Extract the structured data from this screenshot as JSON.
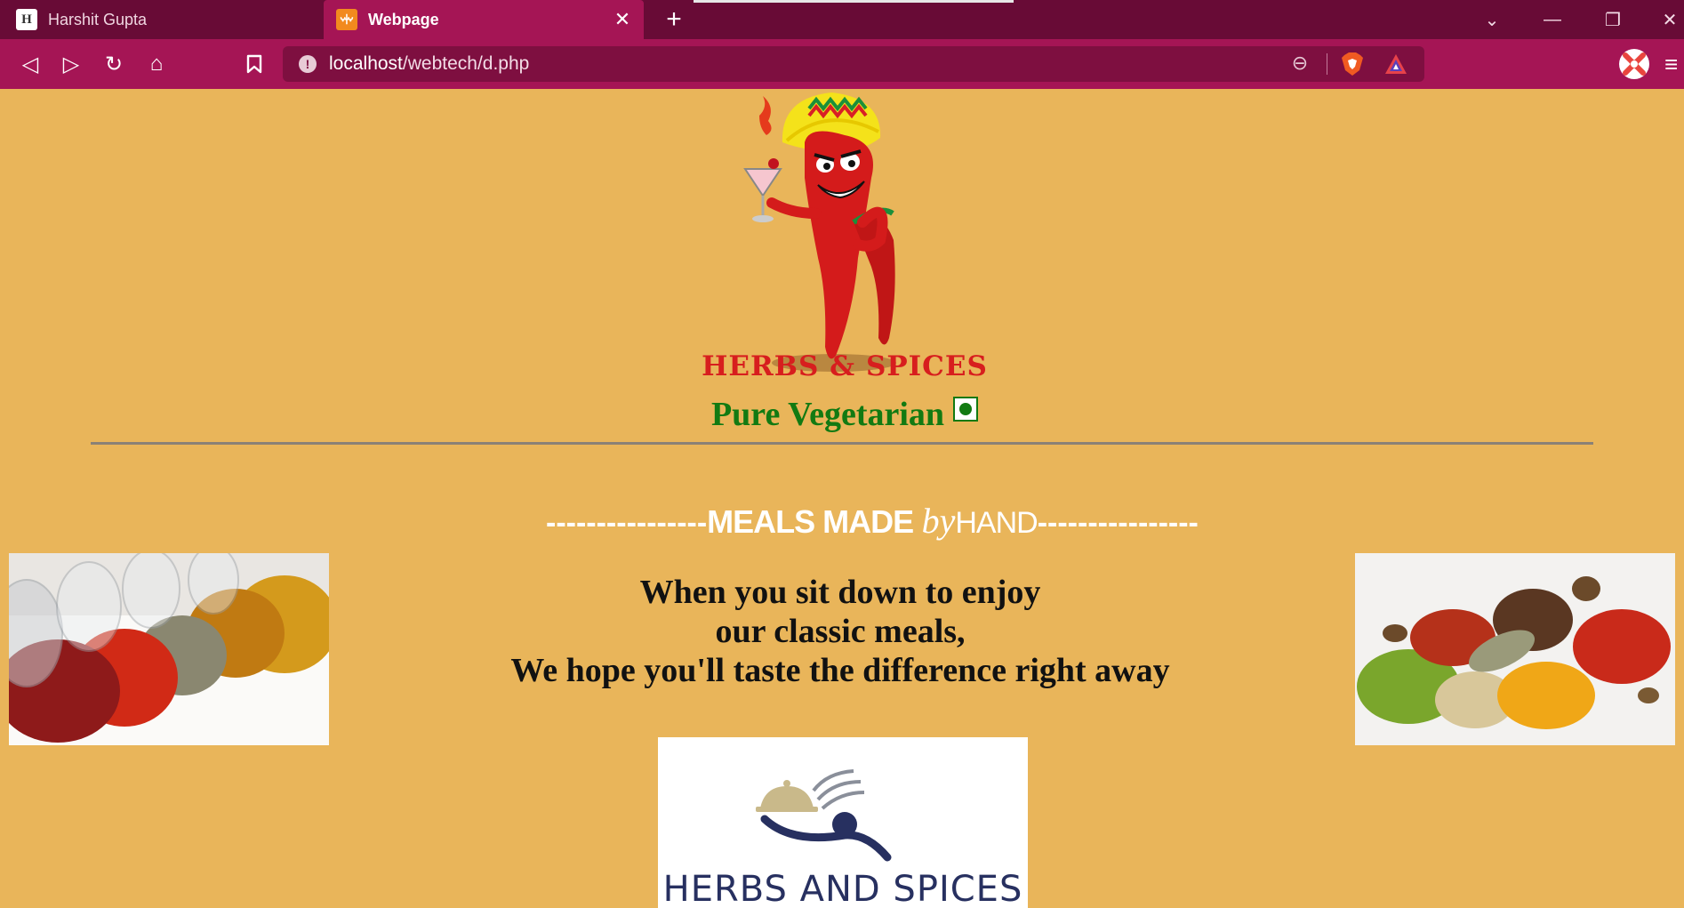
{
  "browser": {
    "tabs": [
      {
        "label": "Harshit Gupta",
        "active": false,
        "icon": "site-favicon"
      },
      {
        "label": "Webpage",
        "active": true,
        "icon": "xampp-favicon"
      }
    ],
    "url": {
      "host": "localhost",
      "path": "/webtech/d.php"
    },
    "icons": {
      "back": "◁",
      "forward": "▷",
      "reload": "↻",
      "home": "⌂",
      "bookmark": "🔖",
      "info": "!",
      "zoom": "⊖",
      "new_tab": "+",
      "close_tab": "✕",
      "tab_search": "⌄",
      "minimize": "—",
      "restore": "❐",
      "close_window": "✕",
      "menu": "≡"
    },
    "favicon_text": {
      "harshit": "H",
      "xampp": "ꗼ"
    }
  },
  "page": {
    "brand_title": "HERBS & SPICES",
    "veg_label": "Pure Vegetarian",
    "meals": {
      "dashes_left": "----------------",
      "made": "MEALS MADE",
      "by": "by",
      "hand": "HAND",
      "dashes_right": "----------------"
    },
    "tagline": [
      "When you sit down to enjoy",
      "our classic meals,",
      "We hope you'll taste the difference right away"
    ],
    "logo_text": "HERBS AND SPICES",
    "colors": {
      "background": "#e9b55a",
      "brand_red": "#d71e1e",
      "veg_green": "#127a12",
      "tab_bar": "#680b36",
      "nav_bar": "#a51555",
      "logo_navy": "#273060"
    }
  }
}
